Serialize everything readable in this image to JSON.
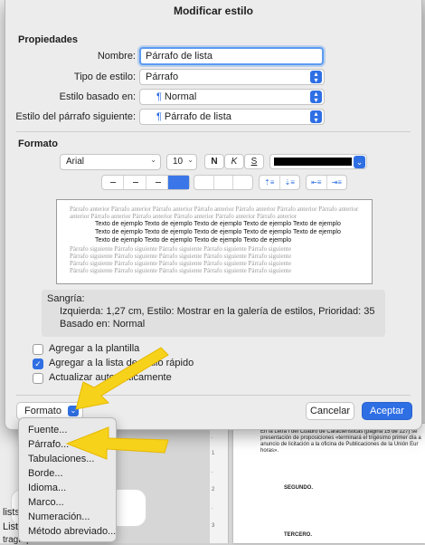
{
  "dialog_title": "Modificar estilo",
  "properties": {
    "section_title": "Propiedades",
    "name_label": "Nombre:",
    "name_value": "Párrafo de lista",
    "type_label": "Tipo de estilo:",
    "type_value": "Párrafo",
    "based_on_label": "Estilo basado en:",
    "based_on_value": "Normal",
    "next_label": "Estilo del párrafo siguiente:",
    "next_value": "Párrafo de lista"
  },
  "format": {
    "section_title": "Formato",
    "font": "Arial",
    "size": "10",
    "bold": "N",
    "italic": "K",
    "underline": "S",
    "font_color": "#000000",
    "accent_color": "#2f6fe4"
  },
  "preview": {
    "prev_lines": [
      "Párrafo anterior Párrafo anterior Párrafo anterior Párrafo anterior Párrafo anterior Párrafo anterior Párrafo anterior",
      "anterior Párrafo anterior Párrafo anterior Párrafo anterior Párrafo anterior Párrafo anterior"
    ],
    "current_lines": [
      "Texto de ejemplo Texto de ejemplo Texto de ejemplo Texto de ejemplo Texto de ejemplo",
      "Texto de ejemplo Texto de ejemplo Texto de ejemplo Texto de ejemplo Texto de ejemplo",
      "Texto de ejemplo Texto de ejemplo Texto de ejemplo Texto de ejemplo"
    ],
    "next_lines": [
      "Párrafo siguiente Párrafo siguiente Párrafo siguiente Párrafo siguiente Párrafo siguiente",
      "Párrafo siguiente Párrafo siguiente Párrafo siguiente Párrafo siguiente Párrafo siguiente",
      "Párrafo siguiente Párrafo siguiente Párrafo siguiente Párrafo siguiente Párrafo siguiente",
      "Párrafo siguiente Párrafo siguiente Párrafo siguiente Párrafo siguiente Párrafo siguiente"
    ]
  },
  "description": {
    "line1": "Sangría:",
    "line2": "Izquierda:  1,27 cm, Estilo: Mostrar en la galería de estilos, Prioridad: 35",
    "line3": "Basado en: Normal"
  },
  "options": {
    "add_template": "Agregar a la plantilla",
    "add_quick_list": "Agregar a la lista de estilo rápido",
    "auto_update": "Actualizar automáticamente",
    "add_template_checked": false,
    "add_quick_list_checked": true,
    "auto_update_checked": false
  },
  "buttons": {
    "formato": "Formato",
    "cancel": "Cancelar",
    "accept": "Aceptar"
  },
  "menu": {
    "items": [
      "Fuente...",
      "Párrafo...",
      "Tabulaciones...",
      "Borde...",
      "Idioma...",
      "Marco...",
      "Numeración...",
      "Método abreviado..."
    ]
  },
  "background": {
    "doc_lines": [
      "En la Letra I del Cuadro de Características (página 15 de 127) se",
      "presentación de proposiciones «terminará el trigésimo primer día a",
      "anuncio de licitación a la oficina de Publicaciones de la Unión Eur",
      "horas»."
    ],
    "doc_heading_1": "SEGUNDO.",
    "doc_heading_2": "TERCERO.",
    "left_text_1": "lists",
    "left_text_2": "List",
    "left_text_3": "tragraph and clear the"
  },
  "annotation_color": "#f7d21b"
}
